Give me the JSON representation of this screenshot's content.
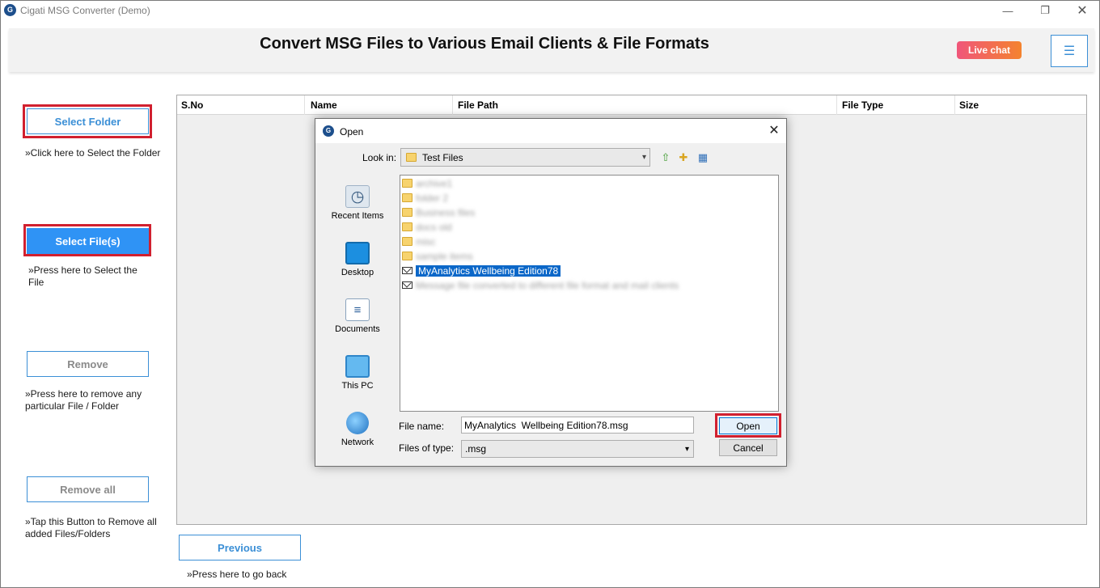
{
  "window": {
    "app_icon": "G",
    "title": "Cigati MSG Converter (Demo)",
    "min_glyph": "—",
    "max_glyph": "❐",
    "close_glyph": "✕"
  },
  "header": {
    "headline": "Convert MSG Files to Various Email Clients & File Formats",
    "live_chat": "Live chat",
    "menu_glyph": "☰"
  },
  "sidebar": {
    "select_folder": "Select Folder",
    "select_folder_hint": "»Click here to Select the Folder",
    "select_files": "Select File(s)",
    "select_files_hint": "»Press here to Select the File",
    "remove": "Remove",
    "remove_hint": "»Press here to remove any particular File / Folder",
    "remove_all": "Remove all",
    "remove_all_hint": "»Tap this Button to Remove all added Files/Folders"
  },
  "table": {
    "columns": [
      "S.No",
      "Name",
      "File Path",
      "File Type",
      "Size"
    ]
  },
  "footer": {
    "previous": "Previous",
    "previous_hint": "»Press here to go back"
  },
  "dialog": {
    "icon": "G",
    "title": "Open",
    "close_glyph": "✕",
    "look_in_label": "Look in:",
    "look_in_value": "Test Files",
    "dropdown_glyph": "▾",
    "places": [
      "Recent Items",
      "Desktop",
      "Documents",
      "This PC",
      "Network"
    ],
    "files": [
      {
        "name": "archive1",
        "type": "folder"
      },
      {
        "name": "folder 2",
        "type": "folder"
      },
      {
        "name": "Business files",
        "type": "folder"
      },
      {
        "name": "docs old",
        "type": "folder"
      },
      {
        "name": "misc",
        "type": "folder"
      },
      {
        "name": "sample items",
        "type": "folder"
      },
      {
        "name": "MyAnalytics  Wellbeing Edition78",
        "type": "msg"
      },
      {
        "name": "Message file converted to different file format and mail clients",
        "type": "msg"
      }
    ],
    "file_name_label": "File name:",
    "file_name_value": "MyAnalytics  Wellbeing Edition78.msg",
    "files_of_type_label": "Files of type:",
    "files_of_type_value": ".msg",
    "open_button": "Open",
    "cancel_button": "Cancel"
  }
}
